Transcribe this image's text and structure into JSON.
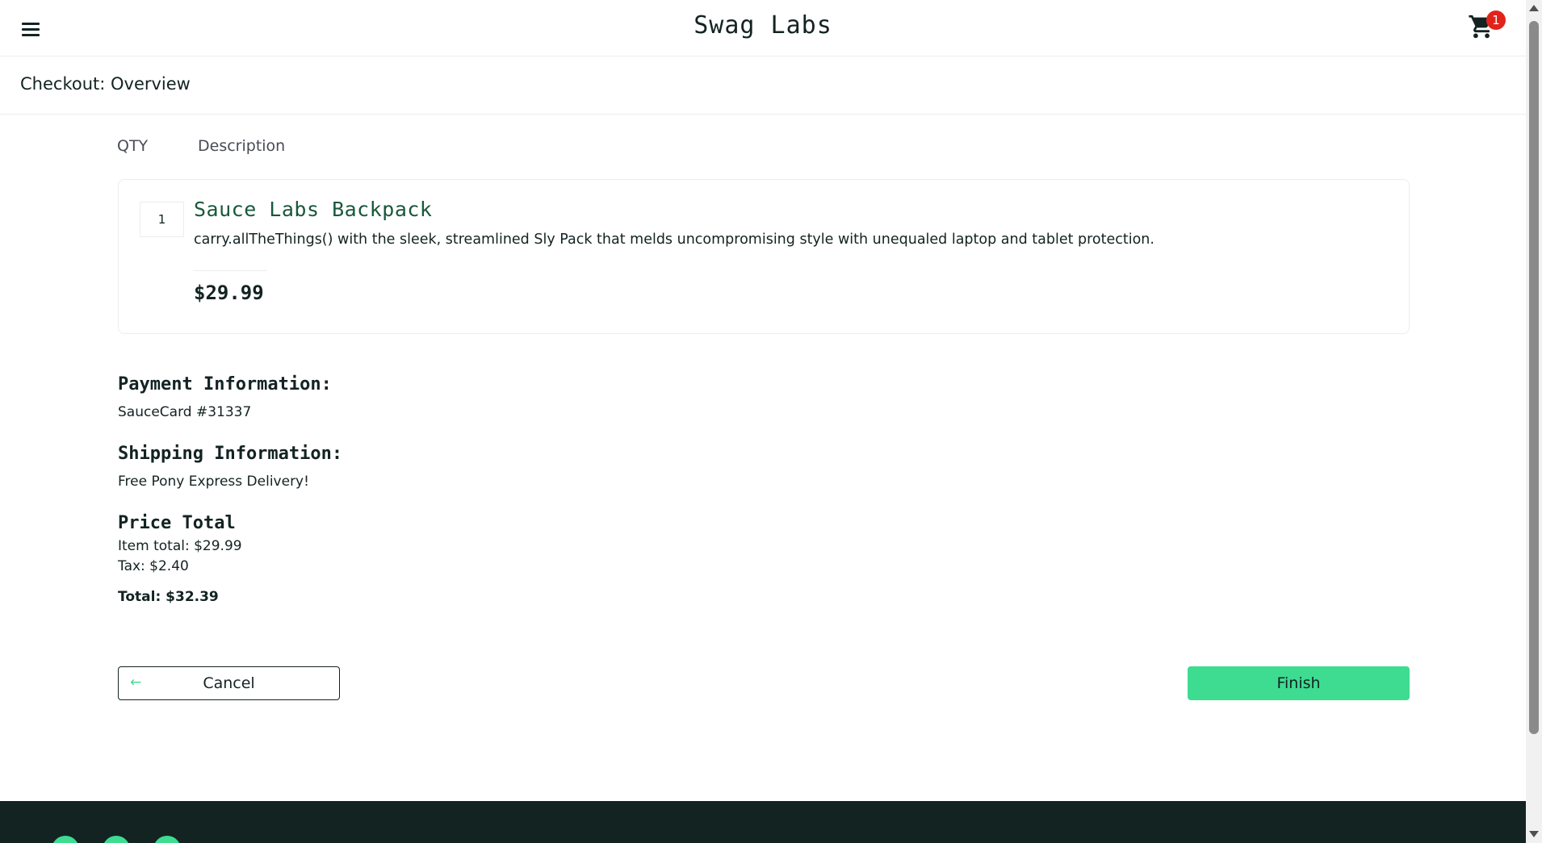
{
  "header": {
    "logo": "Swag Labs",
    "cart_badge_count": "1",
    "menu_icon": "hamburger-menu-icon",
    "cart_icon": "shopping-cart-icon"
  },
  "sub_header": {
    "title": "Checkout: Overview"
  },
  "cart_list": {
    "qty_label": "QTY",
    "description_label": "Description",
    "items": [
      {
        "quantity": "1",
        "name": "Sauce Labs Backpack",
        "description": "carry.allTheThings() with the sleek, streamlined Sly Pack that melds uncompromising style with unequaled laptop and tablet protection.",
        "price": "$29.99"
      }
    ]
  },
  "summary": {
    "payment_heading": "Payment Information:",
    "payment_value": "SauceCard #31337",
    "shipping_heading": "Shipping Information:",
    "shipping_value": "Free Pony Express Delivery!",
    "price_heading": "Price Total",
    "item_total": "Item total: $29.99",
    "tax": "Tax: $2.40",
    "total": "Total: $32.39"
  },
  "buttons": {
    "cancel_label": "Cancel",
    "cancel_icon": "arrow-left-icon",
    "finish_label": "Finish"
  },
  "footer": {
    "social_icons": [
      "twitter-icon",
      "facebook-icon",
      "linkedin-icon"
    ]
  },
  "colors": {
    "accent_green": "#3ddc91",
    "item_name_green": "#18583a",
    "badge_red": "#e2231a",
    "footer_dark": "#132322"
  }
}
